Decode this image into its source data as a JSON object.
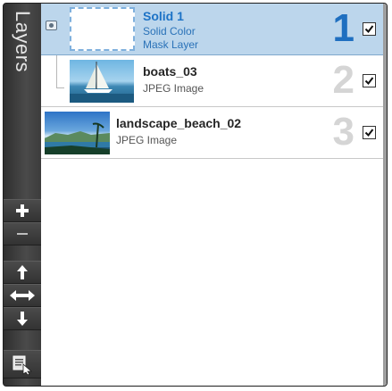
{
  "panel": {
    "title": "Layers"
  },
  "toolbar": {
    "buttons": [
      {
        "name": "add-layer",
        "icon": "plus-icon"
      },
      {
        "name": "remove-layer",
        "icon": "minus-icon"
      },
      {
        "name": "move-up",
        "icon": "arrow-up-icon"
      },
      {
        "name": "move-horizontal",
        "icon": "arrow-left-right-icon"
      },
      {
        "name": "move-down",
        "icon": "arrow-down-icon"
      },
      {
        "name": "layer-properties",
        "icon": "properties-cursor-icon"
      }
    ]
  },
  "layers": [
    {
      "index": "1",
      "name": "Solid 1",
      "type": "Solid Color",
      "subtype": "Mask Layer",
      "visible": true,
      "selected": true,
      "thumbnail": "white-solid-mask"
    },
    {
      "index": "2",
      "name": "boats_03",
      "type": "JPEG Image",
      "visible": true,
      "selected": false,
      "thumbnail": "sailboat-photo"
    },
    {
      "index": "3",
      "name": "landscape_beach_02",
      "type": "JPEG Image",
      "visible": true,
      "selected": false,
      "thumbnail": "beach-photo"
    }
  ],
  "colors": {
    "selection_bg": "#bcd6ec",
    "selection_text": "#1d73c6",
    "sidebar_bg": "#3b3b3b"
  }
}
